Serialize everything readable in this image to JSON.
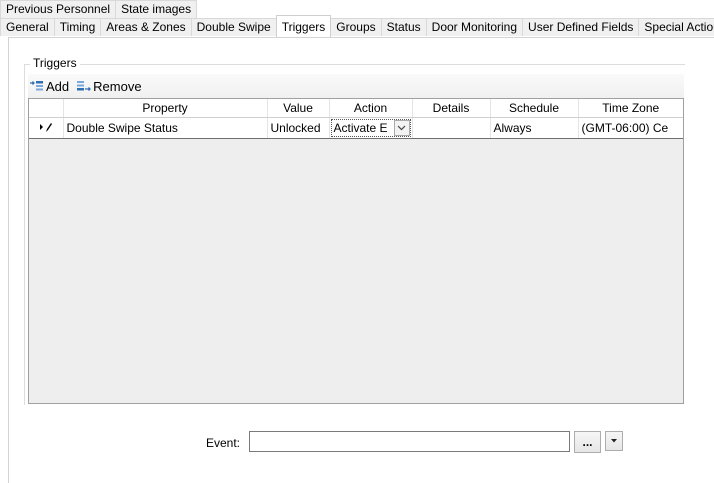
{
  "tabs_row1": [
    "Previous Personnel",
    "State images"
  ],
  "tabs_row2": [
    "General",
    "Timing",
    "Areas & Zones",
    "Double Swipe",
    "Triggers",
    "Groups",
    "Status",
    "Door Monitoring",
    "User Defined Fields",
    "Special Actions"
  ],
  "active_tab": "Triggers",
  "group": {
    "title": "Triggers"
  },
  "toolbar": {
    "add_label": "Add",
    "remove_label": "Remove"
  },
  "grid": {
    "columns": [
      "Property",
      "Value",
      "Action",
      "Details",
      "Schedule",
      "Time Zone"
    ],
    "rows": [
      {
        "property": "Double Swipe Status",
        "value": "Unlocked",
        "action": "Activate E",
        "details": "",
        "schedule": "Always",
        "timezone": "(GMT-06:00) Ce"
      }
    ]
  },
  "event": {
    "label": "Event:",
    "value": "",
    "browse_label": "..."
  },
  "icons": {
    "edit_row": "edit-pencil-icon",
    "add": "add-list-icon",
    "remove": "remove-list-icon",
    "dropdown": "chevron-down-icon"
  },
  "colors": {
    "tab_bg": "#f0f0f0",
    "grid_bg": "#eeeeee",
    "icon_blue": "#2f6fb6"
  }
}
